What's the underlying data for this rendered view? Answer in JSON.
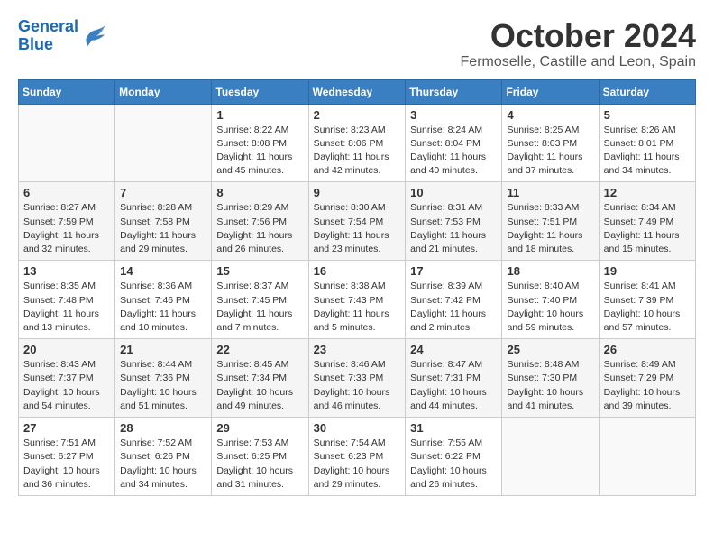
{
  "logo": {
    "text_general": "General",
    "text_blue": "Blue"
  },
  "title": "October 2024",
  "subtitle": "Fermoselle, Castille and Leon, Spain",
  "days_of_week": [
    "Sunday",
    "Monday",
    "Tuesday",
    "Wednesday",
    "Thursday",
    "Friday",
    "Saturday"
  ],
  "weeks": [
    [
      {
        "day": "",
        "info": ""
      },
      {
        "day": "",
        "info": ""
      },
      {
        "day": "1",
        "info": "Sunrise: 8:22 AM\nSunset: 8:08 PM\nDaylight: 11 hours and 45 minutes."
      },
      {
        "day": "2",
        "info": "Sunrise: 8:23 AM\nSunset: 8:06 PM\nDaylight: 11 hours and 42 minutes."
      },
      {
        "day": "3",
        "info": "Sunrise: 8:24 AM\nSunset: 8:04 PM\nDaylight: 11 hours and 40 minutes."
      },
      {
        "day": "4",
        "info": "Sunrise: 8:25 AM\nSunset: 8:03 PM\nDaylight: 11 hours and 37 minutes."
      },
      {
        "day": "5",
        "info": "Sunrise: 8:26 AM\nSunset: 8:01 PM\nDaylight: 11 hours and 34 minutes."
      }
    ],
    [
      {
        "day": "6",
        "info": "Sunrise: 8:27 AM\nSunset: 7:59 PM\nDaylight: 11 hours and 32 minutes."
      },
      {
        "day": "7",
        "info": "Sunrise: 8:28 AM\nSunset: 7:58 PM\nDaylight: 11 hours and 29 minutes."
      },
      {
        "day": "8",
        "info": "Sunrise: 8:29 AM\nSunset: 7:56 PM\nDaylight: 11 hours and 26 minutes."
      },
      {
        "day": "9",
        "info": "Sunrise: 8:30 AM\nSunset: 7:54 PM\nDaylight: 11 hours and 23 minutes."
      },
      {
        "day": "10",
        "info": "Sunrise: 8:31 AM\nSunset: 7:53 PM\nDaylight: 11 hours and 21 minutes."
      },
      {
        "day": "11",
        "info": "Sunrise: 8:33 AM\nSunset: 7:51 PM\nDaylight: 11 hours and 18 minutes."
      },
      {
        "day": "12",
        "info": "Sunrise: 8:34 AM\nSunset: 7:49 PM\nDaylight: 11 hours and 15 minutes."
      }
    ],
    [
      {
        "day": "13",
        "info": "Sunrise: 8:35 AM\nSunset: 7:48 PM\nDaylight: 11 hours and 13 minutes."
      },
      {
        "day": "14",
        "info": "Sunrise: 8:36 AM\nSunset: 7:46 PM\nDaylight: 11 hours and 10 minutes."
      },
      {
        "day": "15",
        "info": "Sunrise: 8:37 AM\nSunset: 7:45 PM\nDaylight: 11 hours and 7 minutes."
      },
      {
        "day": "16",
        "info": "Sunrise: 8:38 AM\nSunset: 7:43 PM\nDaylight: 11 hours and 5 minutes."
      },
      {
        "day": "17",
        "info": "Sunrise: 8:39 AM\nSunset: 7:42 PM\nDaylight: 11 hours and 2 minutes."
      },
      {
        "day": "18",
        "info": "Sunrise: 8:40 AM\nSunset: 7:40 PM\nDaylight: 10 hours and 59 minutes."
      },
      {
        "day": "19",
        "info": "Sunrise: 8:41 AM\nSunset: 7:39 PM\nDaylight: 10 hours and 57 minutes."
      }
    ],
    [
      {
        "day": "20",
        "info": "Sunrise: 8:43 AM\nSunset: 7:37 PM\nDaylight: 10 hours and 54 minutes."
      },
      {
        "day": "21",
        "info": "Sunrise: 8:44 AM\nSunset: 7:36 PM\nDaylight: 10 hours and 51 minutes."
      },
      {
        "day": "22",
        "info": "Sunrise: 8:45 AM\nSunset: 7:34 PM\nDaylight: 10 hours and 49 minutes."
      },
      {
        "day": "23",
        "info": "Sunrise: 8:46 AM\nSunset: 7:33 PM\nDaylight: 10 hours and 46 minutes."
      },
      {
        "day": "24",
        "info": "Sunrise: 8:47 AM\nSunset: 7:31 PM\nDaylight: 10 hours and 44 minutes."
      },
      {
        "day": "25",
        "info": "Sunrise: 8:48 AM\nSunset: 7:30 PM\nDaylight: 10 hours and 41 minutes."
      },
      {
        "day": "26",
        "info": "Sunrise: 8:49 AM\nSunset: 7:29 PM\nDaylight: 10 hours and 39 minutes."
      }
    ],
    [
      {
        "day": "27",
        "info": "Sunrise: 7:51 AM\nSunset: 6:27 PM\nDaylight: 10 hours and 36 minutes."
      },
      {
        "day": "28",
        "info": "Sunrise: 7:52 AM\nSunset: 6:26 PM\nDaylight: 10 hours and 34 minutes."
      },
      {
        "day": "29",
        "info": "Sunrise: 7:53 AM\nSunset: 6:25 PM\nDaylight: 10 hours and 31 minutes."
      },
      {
        "day": "30",
        "info": "Sunrise: 7:54 AM\nSunset: 6:23 PM\nDaylight: 10 hours and 29 minutes."
      },
      {
        "day": "31",
        "info": "Sunrise: 7:55 AM\nSunset: 6:22 PM\nDaylight: 10 hours and 26 minutes."
      },
      {
        "day": "",
        "info": ""
      },
      {
        "day": "",
        "info": ""
      }
    ]
  ]
}
